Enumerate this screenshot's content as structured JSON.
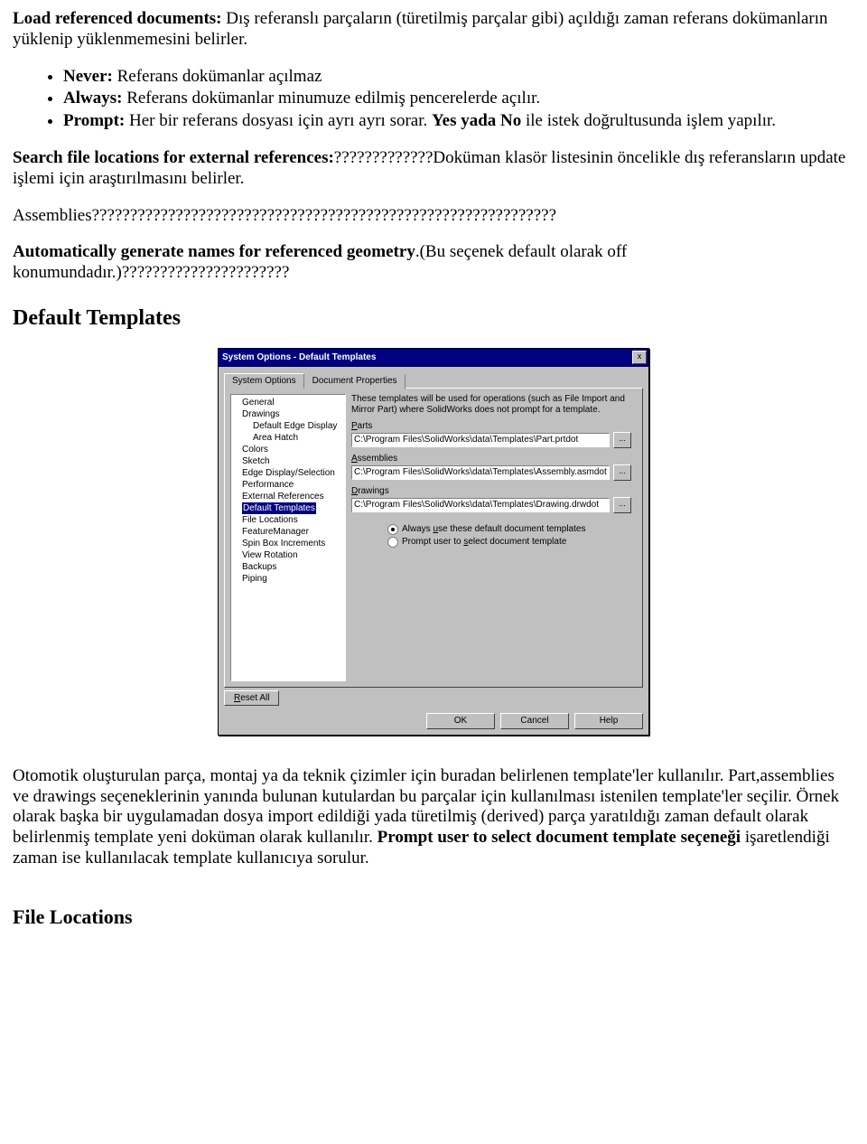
{
  "doc": {
    "p1_label": "Load referenced documents:",
    "p1_rest": " Dış referanslı parçaların (türetilmiş parçalar gibi) açıldığı zaman referans dokümanların yüklenip yüklenmemesini belirler.",
    "bullets": {
      "b1_label": "Never:",
      "b1_rest": " Referans dokümanlar açılmaz",
      "b2_label": "Always:",
      "b2_rest": " Referans dokümanlar minumuze edilmiş pencerelerde açılır.",
      "b3_label": "Prompt:",
      "b3_rest": " Her bir referans dosyası için ayrı ayrı sorar. ",
      "b3_yada": "Yes yada No",
      "b3_tail": " ile istek doğrultusunda işlem yapılır."
    },
    "p2_label": "Search file locations for external references:",
    "p2_rest": "?????????????Doküman klasör listesinin öncelikle dış referansların update işlemi için araştırılmasını belirler.",
    "p3": "Assemblies?????????????????????????????????????????????????????????????",
    "p4_label": "Automatically generate names for referenced geometry",
    "p4_rest": ".(Bu seçenek default olarak off konumundadır.)??????????????????????",
    "h_default_templates": "Default Templates",
    "p5_a": "Otomotik oluşturulan parça, montaj ya da teknik çizimler için buradan belirlenen template'ler kullanılır. Part,assemblies ve drawings seçeneklerinin yanında bulunan kutulardan bu parçalar için kullanılması istenilen template'ler seçilir. Örnek olarak başka bir uygulamadan dosya import edildiği yada türetilmiş (derived) parça yaratıldığı zaman default olarak belirlenmiş template yeni doküman olarak kullanılır. ",
    "p5_b_bold": "Prompt user to select document template seçeneği",
    "p5_c": " işaretlendiği zaman ise kullanılacak template kullanıcıya sorulur.",
    "h_file_locations": "File Locations"
  },
  "dialog": {
    "title": "System Options - Default Templates",
    "close": "x",
    "tabs": {
      "t1": "System Options",
      "t2": "Document Properties"
    },
    "tree": [
      "General",
      "Drawings",
      "Default Edge Display",
      "Area Hatch",
      "Colors",
      "Sketch",
      "Edge Display/Selection",
      "Performance",
      "External References",
      "Default Templates",
      "File Locations",
      "FeatureManager",
      "Spin Box Increments",
      "View Rotation",
      "Backups",
      "Piping"
    ],
    "intro": "These templates will be used for operations (such as File Import and Mirror Part) where SolidWorks does not prompt for a template.",
    "fields": {
      "parts_label": "Parts",
      "parts_value": "C:\\Program Files\\SolidWorks\\data\\Templates\\Part.prtdot",
      "asm_label": "Assemblies",
      "asm_value": "C:\\Program Files\\SolidWorks\\data\\Templates\\Assembly.asmdot",
      "drw_label": "Drawings",
      "drw_value": "C:\\Program Files\\SolidWorks\\data\\Templates\\Drawing.drwdot",
      "browse": "..."
    },
    "radios": {
      "r1": "Always use these default document templates",
      "r2": "Prompt user to select document template"
    },
    "buttons": {
      "reset": "Reset All",
      "ok": "OK",
      "cancel": "Cancel",
      "help": "Help"
    }
  }
}
